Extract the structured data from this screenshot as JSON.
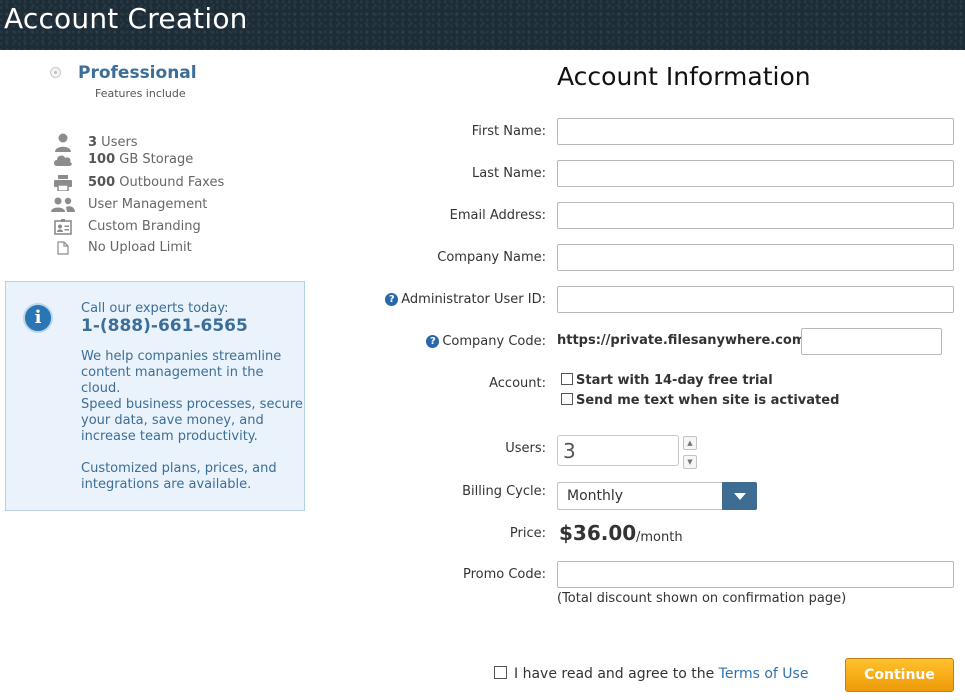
{
  "header": {
    "title": "Account Creation"
  },
  "plan": {
    "name": "Professional",
    "subtitle": "Features include",
    "features": [
      {
        "icon": "user-icon",
        "bold": "3",
        "text": " Users"
      },
      {
        "icon": "cloud-icon",
        "bold": "100",
        "text": " GB Storage"
      },
      {
        "icon": "printer-icon",
        "bold": "500",
        "text": " Outbound Faxes"
      },
      {
        "icon": "users-group-icon",
        "bold": "",
        "text": "User Management"
      },
      {
        "icon": "id-card-icon",
        "bold": "",
        "text": "Custom Branding"
      },
      {
        "icon": "file-icon",
        "bold": "",
        "text": "No Upload Limit"
      }
    ]
  },
  "info": {
    "call_label": "Call our experts today:",
    "phone": "1-(888)-661-6565",
    "paragraph1": "We help companies streamline content management in the cloud.",
    "paragraph2": "Speed business processes, secure your data, save money, and increase team productivity.",
    "paragraph3": "Customized plans, prices, and integrations are available."
  },
  "form": {
    "title": "Account Information",
    "labels": {
      "first_name": "First Name:",
      "last_name": "Last Name:",
      "email": "Email Address:",
      "company_name": "Company Name:",
      "admin_user_id": "Administrator User ID:",
      "company_code": "Company Code:",
      "account": "Account:",
      "users": "Users:",
      "billing_cycle": "Billing Cycle:",
      "price": "Price:",
      "promo_code": "Promo Code:"
    },
    "values": {
      "first_name": "",
      "last_name": "",
      "email": "",
      "company_name": "",
      "admin_user_id": "",
      "company_code": "",
      "promo_code": ""
    },
    "company_url_prefix": "https://private.filesanywhere.com/",
    "account_options": {
      "trial": "Start with 14-day free trial",
      "text_me": "Send me text when site is activated"
    },
    "users_value": "3",
    "billing_cycle_value": "Monthly",
    "price_value": "$36.00",
    "price_unit": "/month",
    "promo_note": "(Total discount shown on confirmation page)"
  },
  "footer": {
    "agree_text": "I have read and agree to the ",
    "terms_link": "Terms of Use",
    "continue_label": "Continue"
  },
  "colors": {
    "header_bg": "#1d2d37",
    "accent_blue": "#3c6e98",
    "button_orange": "#f5a81a",
    "select_arrow_bg": "#3e6d93"
  }
}
